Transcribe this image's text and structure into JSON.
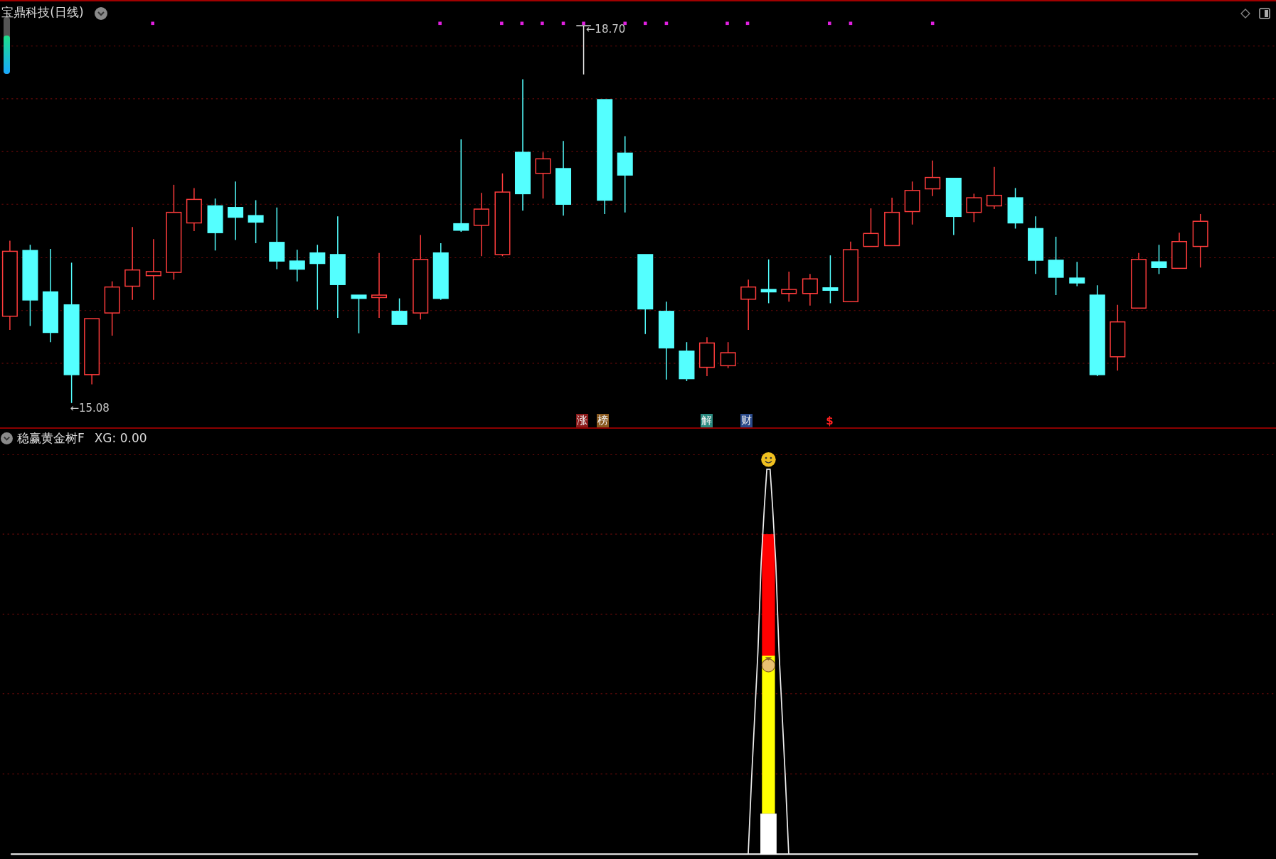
{
  "chart": {
    "title": "宝鼎科技(日线)",
    "meter": {
      "level": 0.68
    },
    "high_label": "←18.70",
    "low_label": "←15.08",
    "markers": [
      {
        "kind": "tag",
        "text": "涨",
        "color": "#8b1a1a"
      },
      {
        "kind": "tag",
        "text": "榜",
        "color": "#8a5a20"
      },
      {
        "kind": "tag",
        "text": "解",
        "color": "#2a8a80"
      },
      {
        "kind": "tag",
        "text": "财",
        "color": "#2a4a8a"
      },
      {
        "kind": "symbol",
        "text": "$",
        "color": "#ff2020"
      }
    ]
  },
  "indicator": {
    "name": "稳赢黄金树F",
    "reading": "XG: 0.00"
  }
}
